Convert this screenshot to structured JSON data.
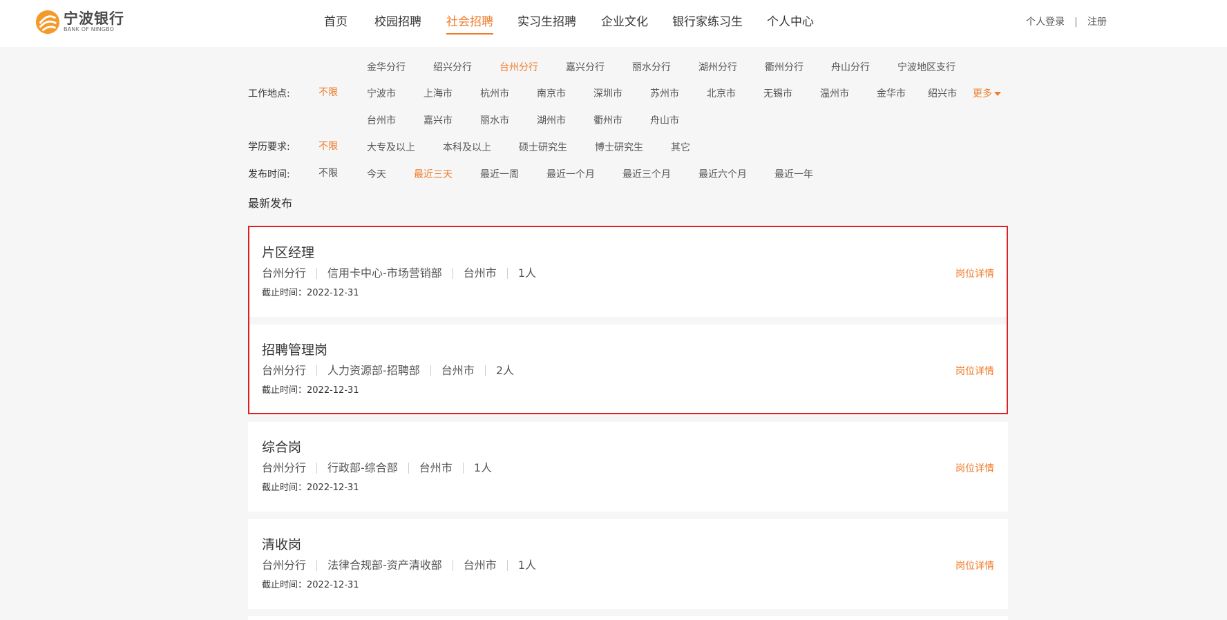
{
  "header": {
    "logo_cn": "宁波银行",
    "logo_en": "BANK OF NINGBO",
    "nav": [
      "首页",
      "校园招聘",
      "社会招聘",
      "实习生招聘",
      "企业文化",
      "银行家练习生",
      "个人中心"
    ],
    "active_nav": "社会招聘",
    "login": "个人登录",
    "divider": "|",
    "register": "注册"
  },
  "filters": {
    "location": {
      "label": "工作地点:",
      "all": "不限",
      "branches": [
        "金华分行",
        "绍兴分行",
        "台州分行",
        "嘉兴分行",
        "丽水分行",
        "湖州分行",
        "衢州分行",
        "舟山分行",
        "宁波地区支行"
      ],
      "active": "台州分行",
      "cities_row1": [
        "宁波市",
        "上海市",
        "杭州市",
        "南京市",
        "深圳市",
        "苏州市",
        "北京市",
        "无锡市",
        "温州市",
        "金华市",
        "绍兴市"
      ],
      "more": "更多",
      "cities_row2": [
        "台州市",
        "嘉兴市",
        "丽水市",
        "湖州市",
        "衢州市",
        "舟山市"
      ]
    },
    "education": {
      "label": "学历要求:",
      "all": "不限",
      "options": [
        "大专及以上",
        "本科及以上",
        "硕士研究生",
        "博士研究生",
        "其它"
      ]
    },
    "time": {
      "label": "发布时间:",
      "all": "不限",
      "options": [
        "今天",
        "最近三天",
        "最近一周",
        "最近一个月",
        "最近三个月",
        "最近六个月",
        "最近一年"
      ],
      "active": "最近三天"
    }
  },
  "section_title": "最新发布",
  "jobs": [
    {
      "title": "片区经理",
      "branch": "台州分行",
      "dept": "信用卡中心-市场营销部",
      "city": "台州市",
      "count": "1人",
      "deadline": "截止时间：2022-12-31",
      "link": "岗位详情"
    },
    {
      "title": "招聘管理岗",
      "branch": "台州分行",
      "dept": "人力资源部-招聘部",
      "city": "台州市",
      "count": "2人",
      "deadline": "截止时间：2022-12-31",
      "link": "岗位详情"
    },
    {
      "title": "综合岗",
      "branch": "台州分行",
      "dept": "行政部-综合部",
      "city": "台州市",
      "count": "1人",
      "deadline": "截止时间：2022-12-31",
      "link": "岗位详情"
    },
    {
      "title": "清收岗",
      "branch": "台州分行",
      "dept": "法律合规部-资产清收部",
      "city": "台州市",
      "count": "1人",
      "deadline": "截止时间：2022-12-31",
      "link": "岗位详情"
    }
  ],
  "colors": {
    "accent": "#f07c2a",
    "highlight": "#e02020"
  }
}
